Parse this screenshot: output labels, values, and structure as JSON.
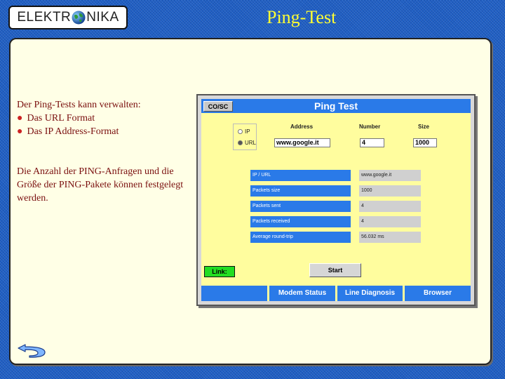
{
  "header": {
    "logo": {
      "left": "ELEKTR",
      "right": "NIKA",
      "icon": "globe-icon"
    },
    "title": "Ping-Test"
  },
  "text": {
    "intro": "Der Ping-Tests kann verwalten:",
    "bullets": [
      "Das URL Format",
      "Das IP Address-Format"
    ],
    "paragraph": "Die Anzahl der PING-Anfragen und die Größe der PING-Pakete können festgelegt werden."
  },
  "navigation": {
    "back_icon": "back-arrow-icon"
  },
  "app": {
    "cosc_label": "CO/SC",
    "title": "Ping Test",
    "radio_options": [
      {
        "label": "IP",
        "selected": false
      },
      {
        "label": "URL",
        "selected": true
      }
    ],
    "columns": {
      "address": "Address",
      "number": "Number",
      "size": "Size"
    },
    "inputs": {
      "address": "www.google.it",
      "number": "4",
      "size": "1000"
    },
    "results": [
      {
        "label": "IP / URL",
        "value": "www.google.it"
      },
      {
        "label": "Packets size",
        "value": "1000"
      },
      {
        "label": "Packets sent",
        "value": "4"
      },
      {
        "label": "Packets received",
        "value": "4"
      },
      {
        "label": "Average round-trip",
        "value": "56.032 ms"
      }
    ],
    "link_label": "Link:",
    "start_label": "Start",
    "bottom_tabs": [
      "Modem Status",
      "Line Diagnosis",
      "Browser"
    ]
  },
  "colors": {
    "background": "#1f5fc4",
    "title": "#ffff33",
    "slide": "#ffffe6",
    "text": "#7a0f0f",
    "app_bar": "#2a7ae8",
    "app_bg": "#fffd9e",
    "link_indicator": "#22dd22"
  }
}
